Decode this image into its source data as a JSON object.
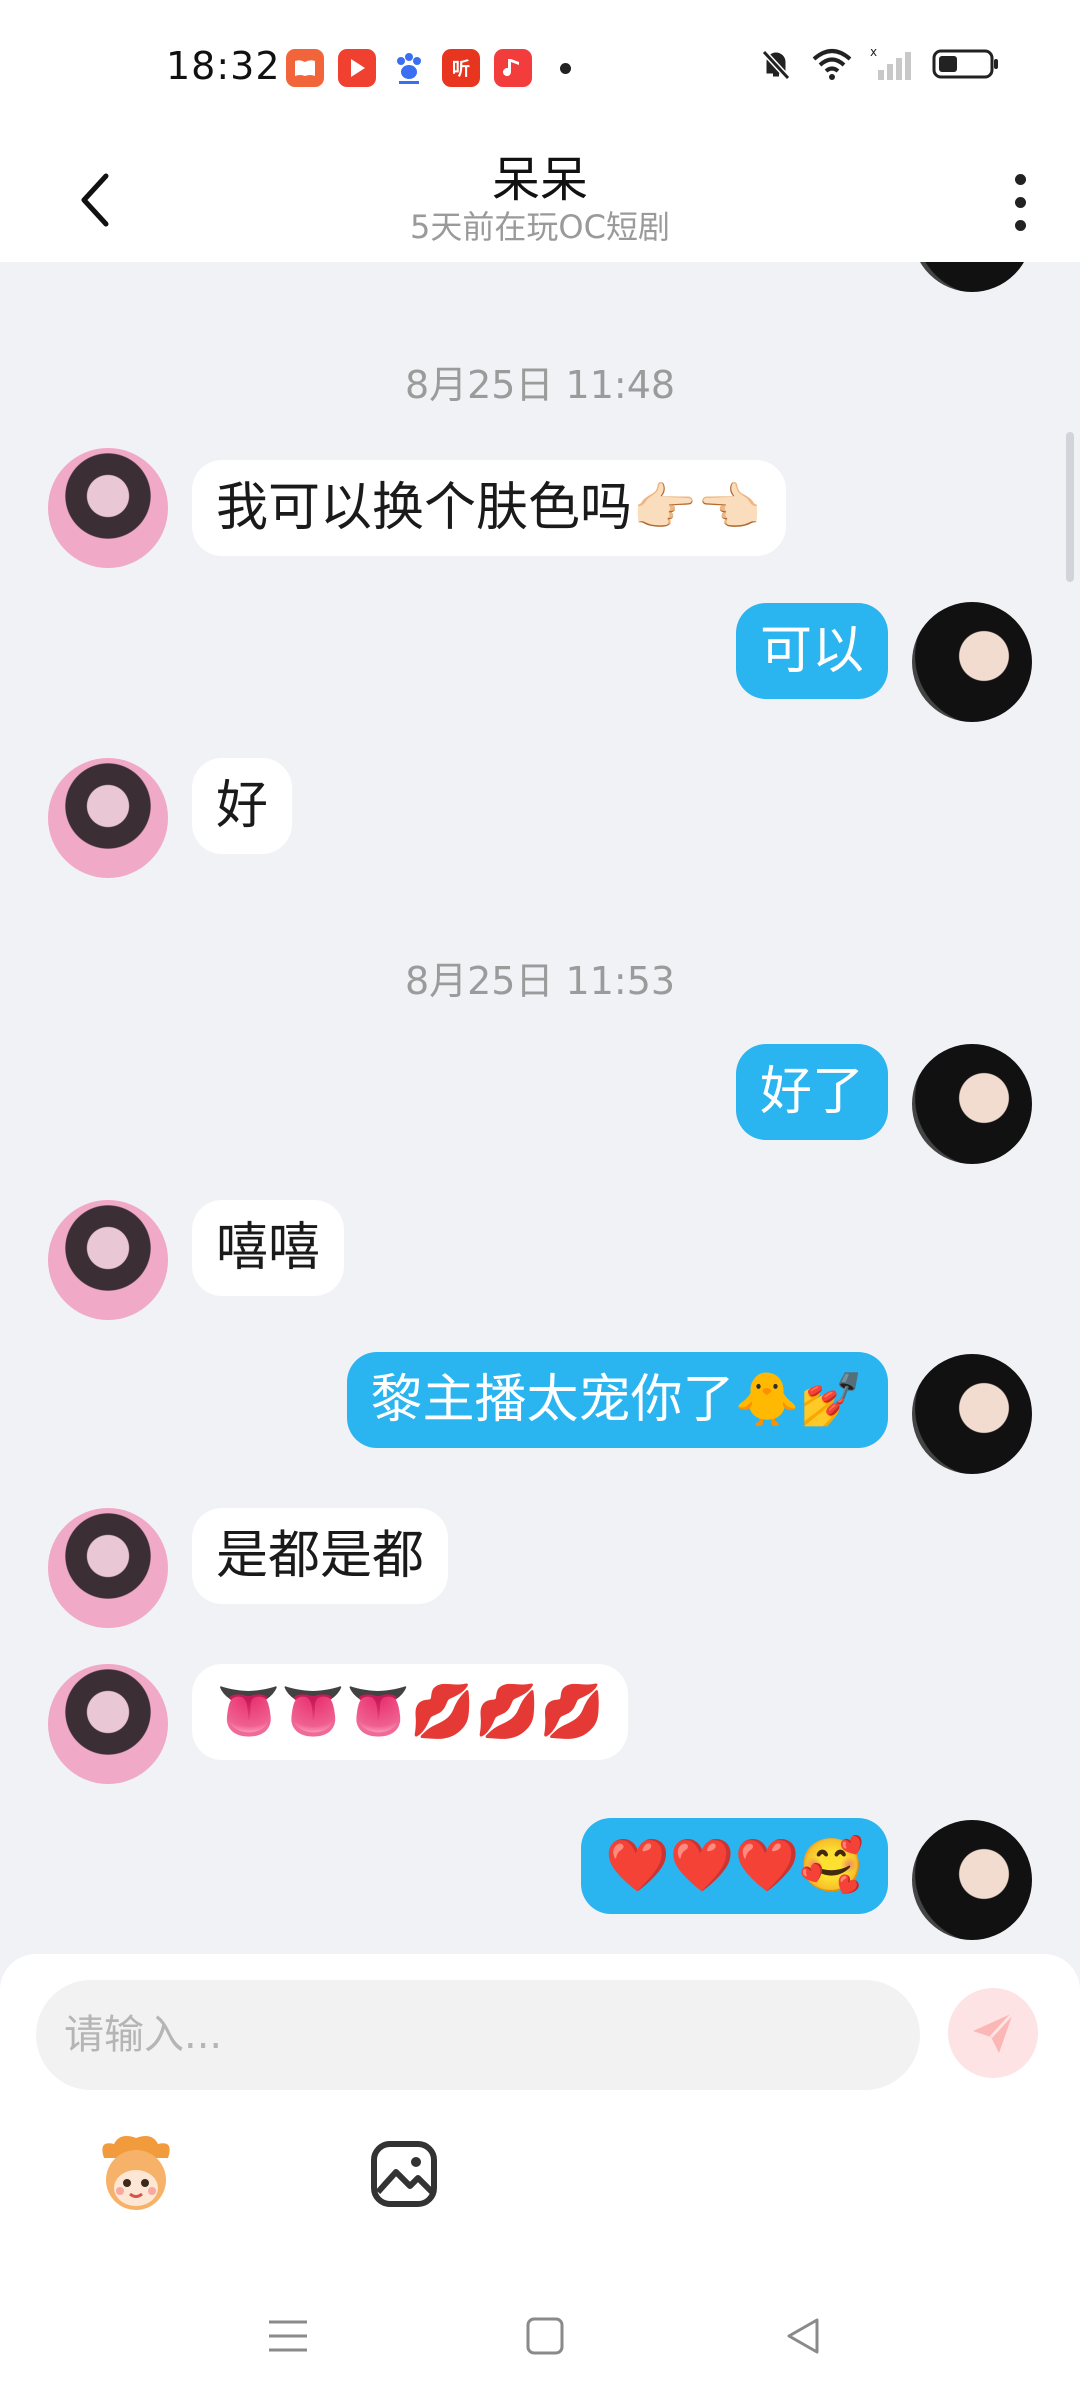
{
  "status_bar": {
    "time": "18:32",
    "app_icons": [
      "book-app-icon",
      "video-app-icon",
      "baidu-paw-icon",
      "listen-app-icon",
      "music-app-icon"
    ],
    "listen_icon_text": "听"
  },
  "header": {
    "title": "呆呆",
    "subtitle": "5天前在玩OC短剧"
  },
  "messages": [
    {
      "type": "time",
      "text": "8月25日 11:48"
    },
    {
      "type": "them",
      "text": "我可以换个肤色吗👉🏻👈🏻"
    },
    {
      "type": "me",
      "text": "可以"
    },
    {
      "type": "them",
      "text": "好"
    },
    {
      "type": "time",
      "text": "8月25日 11:53"
    },
    {
      "type": "me",
      "text": "好了"
    },
    {
      "type": "them",
      "text": "嘻嘻"
    },
    {
      "type": "me",
      "text": "黎主播太宠你了🐥💅"
    },
    {
      "type": "them",
      "text": "是都是都"
    },
    {
      "type": "them",
      "text": "👅👅👅💋💋💋"
    },
    {
      "type": "me",
      "text": "❤️❤️❤️🥰"
    }
  ],
  "composer": {
    "placeholder": "请输入...",
    "tools": [
      "mascot-sticker-icon",
      "image-icon"
    ]
  },
  "colors": {
    "accent": "#2ab4f0",
    "background": "#f1f2f6"
  }
}
